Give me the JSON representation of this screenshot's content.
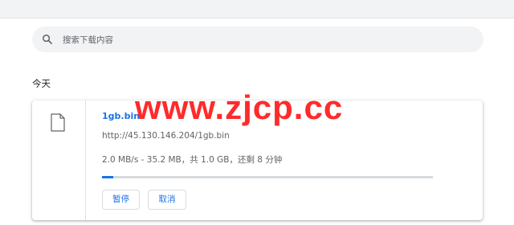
{
  "search": {
    "placeholder": "搜索下载内容",
    "icon": "search-icon"
  },
  "section": {
    "title": "今天"
  },
  "download": {
    "file_name": "1gb.bin",
    "url": "http://45.130.146.204/1gb.bin",
    "status": "2.0 MB/s - 35.2 MB，共 1.0 GB，还剩 8 分钟",
    "progress_percent": 3.4,
    "file_icon": "file-icon",
    "pause_label": "暂停",
    "cancel_label": "取消"
  },
  "watermark": {
    "text": "www.zjcp.cc"
  },
  "colors": {
    "accent": "#1a73e8",
    "watermark": "#ff2b2b",
    "toolbar": "#f1f3f4"
  }
}
